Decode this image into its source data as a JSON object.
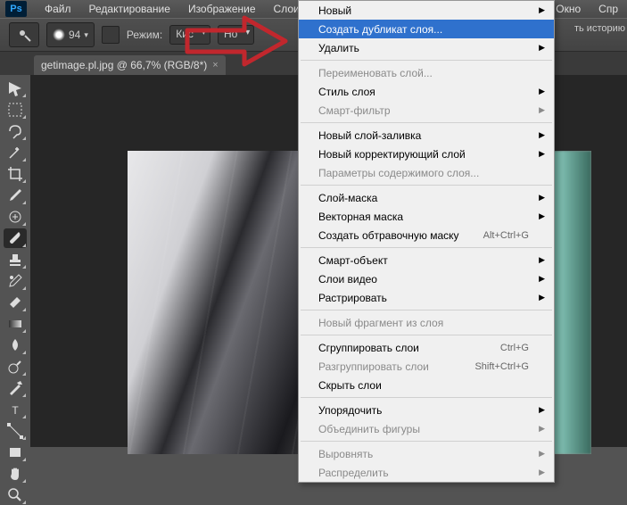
{
  "menubar": {
    "items": [
      "Файл",
      "Редактирование",
      "Изображение",
      "Слои"
    ],
    "right": [
      "Окно",
      "Спр"
    ]
  },
  "optbar": {
    "brush_size": "94",
    "mode_label": "Режим:",
    "mode_value": "Кис",
    "opacity_value": "Но",
    "history_text": "ть историю"
  },
  "tab": {
    "title": "getimage.pl.jpg @ 66,7% (RGB/8*)"
  },
  "context_menu": {
    "groups": [
      [
        {
          "label": "Новый",
          "sub": true
        },
        {
          "label": "Создать дубликат слоя...",
          "highlight": true
        },
        {
          "label": "Удалить",
          "sub": true
        }
      ],
      [
        {
          "label": "Переименовать слой...",
          "disabled": true
        },
        {
          "label": "Стиль слоя",
          "sub": true
        },
        {
          "label": "Смарт-фильтр",
          "sub": true,
          "disabled": true
        }
      ],
      [
        {
          "label": "Новый слой-заливка",
          "sub": true
        },
        {
          "label": "Новый корректирующий слой",
          "sub": true
        },
        {
          "label": "Параметры содержимого слоя...",
          "disabled": true
        }
      ],
      [
        {
          "label": "Слой-маска",
          "sub": true
        },
        {
          "label": "Векторная маска",
          "sub": true
        },
        {
          "label": "Создать обтравочную маску",
          "shortcut": "Alt+Ctrl+G"
        }
      ],
      [
        {
          "label": "Смарт-объект",
          "sub": true
        },
        {
          "label": "Слои видео",
          "sub": true
        },
        {
          "label": "Растрировать",
          "sub": true
        }
      ],
      [
        {
          "label": "Новый фрагмент из слоя",
          "disabled": true
        }
      ],
      [
        {
          "label": "Сгруппировать слои",
          "shortcut": "Ctrl+G"
        },
        {
          "label": "Разгруппировать слои",
          "shortcut": "Shift+Ctrl+G",
          "disabled": true
        },
        {
          "label": "Скрыть слои"
        }
      ],
      [
        {
          "label": "Упорядочить",
          "sub": true
        },
        {
          "label": "Объединить фигуры",
          "sub": true,
          "disabled": true
        }
      ],
      [
        {
          "label": "Выровнять",
          "sub": true,
          "disabled": true
        },
        {
          "label": "Распределить",
          "sub": true,
          "disabled": true
        }
      ]
    ]
  },
  "tools": [
    "move",
    "marquee",
    "lasso",
    "wand",
    "crop",
    "eyedropper",
    "heal",
    "brush",
    "stamp",
    "history",
    "eraser",
    "gradient",
    "blur",
    "dodge",
    "pen",
    "type",
    "path",
    "rect",
    "hand",
    "zoom"
  ]
}
